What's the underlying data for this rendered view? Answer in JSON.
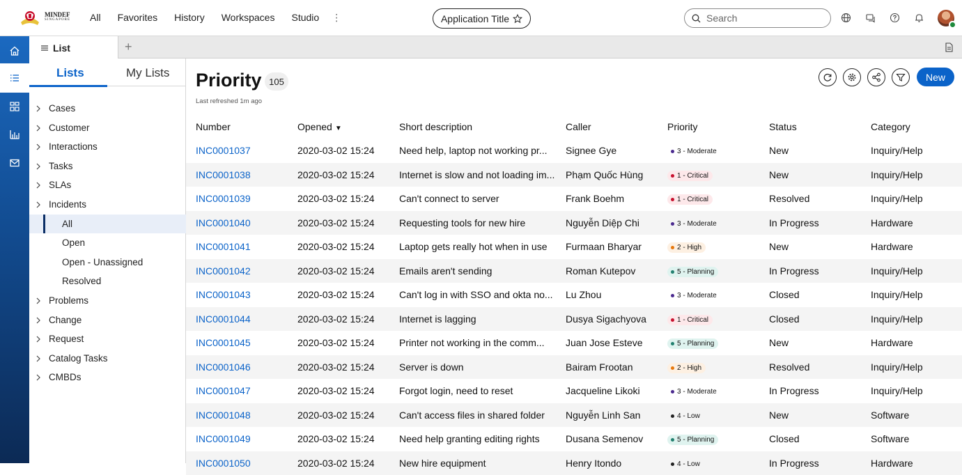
{
  "header": {
    "logo_text": "MINDEF",
    "logo_subtext": "SINGAPORE",
    "nav": [
      "All",
      "Favorites",
      "History",
      "Workspaces",
      "Studio"
    ],
    "more_glyph": "⋮",
    "app_title": "Application Title",
    "search_placeholder": "Search",
    "icons": [
      "globe-icon",
      "chat-icon",
      "help-icon",
      "bell-icon"
    ]
  },
  "rail": {
    "items": [
      "home-icon",
      "list-icon",
      "dashboard-icon",
      "analytics-icon",
      "mail-icon"
    ],
    "active": "list-icon"
  },
  "tabstrip": {
    "tab_label": "List",
    "add_glyph": "+"
  },
  "lists_panel": {
    "tabs": [
      "Lists",
      "My Lists"
    ],
    "active_tab": "Lists",
    "tree": [
      {
        "label": "Cases",
        "level": 0
      },
      {
        "label": "Customer",
        "level": 0
      },
      {
        "label": "Interactions",
        "level": 0
      },
      {
        "label": "Tasks",
        "level": 0
      },
      {
        "label": "SLAs",
        "level": 0
      },
      {
        "label": "Incidents",
        "level": 0
      },
      {
        "label": "All",
        "level": 1,
        "selected": true
      },
      {
        "label": "Open",
        "level": 1
      },
      {
        "label": "Open - Unassigned",
        "level": 1
      },
      {
        "label": "Resolved",
        "level": 1
      },
      {
        "label": "Problems",
        "level": 0
      },
      {
        "label": "Change",
        "level": 0
      },
      {
        "label": "Request",
        "level": 0
      },
      {
        "label": "Catalog Tasks",
        "level": 0
      },
      {
        "label": "CMBDs",
        "level": 0
      }
    ]
  },
  "main": {
    "title": "Priority",
    "count": "105",
    "refreshed": "Last refreshed 1m ago",
    "new_label": "New",
    "tool_icons": [
      "refresh-icon",
      "settings-icon",
      "share-icon",
      "filter-icon"
    ],
    "columns": [
      "Number",
      "Opened",
      "Short description",
      "Caller",
      "Priority",
      "Status",
      "Category"
    ],
    "sort_column": "Opened",
    "sort_direction": "descending",
    "rows": [
      {
        "number": "INC0001037",
        "opened": "2020-03-02 15:24",
        "desc": "Need help, laptop not working pr...",
        "caller": "Signee Gye",
        "priority": "3 - Moderate",
        "ptype": "moderate",
        "status": "New",
        "category": "Inquiry/Help"
      },
      {
        "number": "INC0001038",
        "opened": "2020-03-02 15:24",
        "desc": "Internet is slow and not loading im...",
        "caller": "Phạm Quốc Hùng",
        "priority": "1 - Critical",
        "ptype": "critical",
        "status": "New",
        "category": "Inquiry/Help"
      },
      {
        "number": "INC0001039",
        "opened": "2020-03-02 15:24",
        "desc": "Can't connect to server",
        "caller": "Frank Boehm",
        "priority": "1 - Critical",
        "ptype": "critical",
        "status": "Resolved",
        "category": "Inquiry/Help"
      },
      {
        "number": "INC0001040",
        "opened": "2020-03-02 15:24",
        "desc": "Requesting tools for new hire",
        "caller": "Nguyễn Diệp Chi",
        "priority": "3 - Moderate",
        "ptype": "moderate",
        "status": "In Progress",
        "category": "Hardware"
      },
      {
        "number": "INC0001041",
        "opened": "2020-03-02 15:24",
        "desc": "Laptop gets really hot when in use",
        "caller": "Furmaan Bharyar",
        "priority": "2 - High",
        "ptype": "high",
        "status": "New",
        "category": "Hardware"
      },
      {
        "number": "INC0001042",
        "opened": "2020-03-02 15:24",
        "desc": "Emails aren't sending",
        "caller": "Roman Kutepov",
        "priority": "5 - Planning",
        "ptype": "planning",
        "status": "In Progress",
        "category": "Inquiry/Help"
      },
      {
        "number": "INC0001043",
        "opened": "2020-03-02 15:24",
        "desc": "Can't log in with SSO and okta no...",
        "caller": "Lu Zhou",
        "priority": "3 - Moderate",
        "ptype": "moderate",
        "status": "Closed",
        "category": "Inquiry/Help"
      },
      {
        "number": "INC0001044",
        "opened": "2020-03-02 15:24",
        "desc": "Internet is lagging",
        "caller": "Dusya Sigachyova",
        "priority": "1 - Critical",
        "ptype": "critical",
        "status": "Closed",
        "category": "Inquiry/Help"
      },
      {
        "number": "INC0001045",
        "opened": "2020-03-02 15:24",
        "desc": "Printer not working in the comm...",
        "caller": "Juan Jose Esteve",
        "priority": "5 - Planning",
        "ptype": "planning",
        "status": "New",
        "category": "Hardware"
      },
      {
        "number": "INC0001046",
        "opened": "2020-03-02 15:24",
        "desc": "Server is down",
        "caller": "Bairam Frootan",
        "priority": "2 - High",
        "ptype": "high",
        "status": "Resolved",
        "category": "Inquiry/Help"
      },
      {
        "number": "INC0001047",
        "opened": "2020-03-02 15:24",
        "desc": "Forgot login, need to reset",
        "caller": "Jacqueline Likoki",
        "priority": "3 - Moderate",
        "ptype": "moderate",
        "status": "In Progress",
        "category": "Inquiry/Help"
      },
      {
        "number": "INC0001048",
        "opened": "2020-03-02 15:24",
        "desc": "Can't access files in shared folder",
        "caller": "Nguyễn Linh San",
        "priority": "4 - Low",
        "ptype": "low",
        "status": "New",
        "category": "Software"
      },
      {
        "number": "INC0001049",
        "opened": "2020-03-02 15:24",
        "desc": "Need help granting editing rights",
        "caller": "Dusana Semenov",
        "priority": "5 - Planning",
        "ptype": "planning",
        "status": "Closed",
        "category": "Software"
      },
      {
        "number": "INC0001050",
        "opened": "2020-03-02 15:24",
        "desc": "New hire equipment",
        "caller": "Henry Itondo",
        "priority": "4 - Low",
        "ptype": "low",
        "status": "In Progress",
        "category": "Hardware"
      }
    ]
  },
  "colors": {
    "accent": "#0b63c9",
    "rail_top": "#1b69c0",
    "rail_bottom": "#0c2a55",
    "critical": "#c8102e",
    "high": "#e8780c",
    "moderate": "#4b2a8f",
    "planning": "#23806f",
    "low": "#222222"
  }
}
